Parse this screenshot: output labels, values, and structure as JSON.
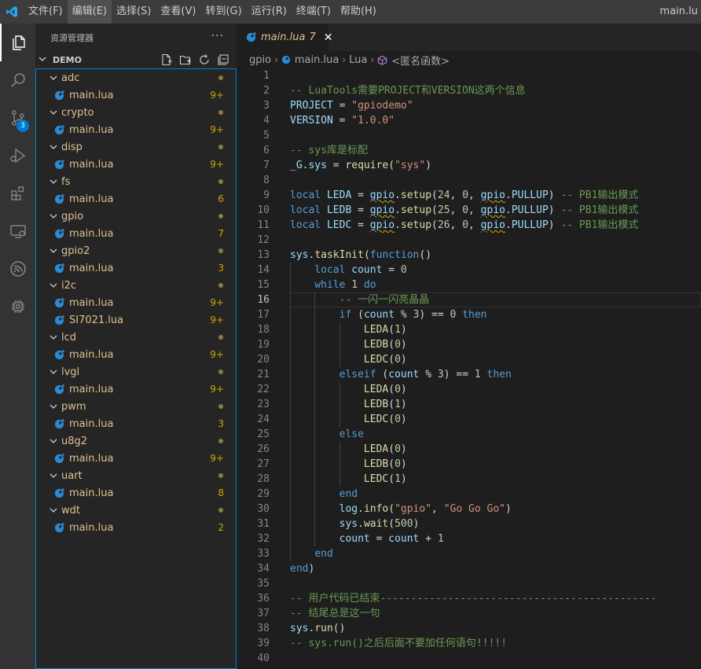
{
  "titlebar": {
    "menu": [
      "文件(F)",
      "编辑(E)",
      "选择(S)",
      "查看(V)",
      "转到(G)",
      "运行(R)",
      "终端(T)",
      "帮助(H)"
    ],
    "window_title": "main.lu"
  },
  "activity": {
    "icons": [
      "explorer-icon",
      "search-icon",
      "source-control-icon",
      "run-debug-icon",
      "extensions-icon",
      "remote-explorer-icon",
      "wifi-icon",
      "chip-icon"
    ],
    "scm_badge": "3"
  },
  "sidebar": {
    "title": "资源管理器",
    "workspace": "DEMO",
    "tree": [
      {
        "folder": "adc",
        "files": [
          {
            "name": "main.lua",
            "count": "9+"
          }
        ]
      },
      {
        "folder": "crypto",
        "files": [
          {
            "name": "main.lua",
            "count": "9+"
          }
        ]
      },
      {
        "folder": "disp",
        "files": [
          {
            "name": "main.lua",
            "count": "9+"
          }
        ]
      },
      {
        "folder": "fs",
        "files": [
          {
            "name": "main.lua",
            "count": "6"
          }
        ]
      },
      {
        "folder": "gpio",
        "files": [
          {
            "name": "main.lua",
            "count": "7"
          }
        ]
      },
      {
        "folder": "gpio2",
        "files": [
          {
            "name": "main.lua",
            "count": "3"
          }
        ]
      },
      {
        "folder": "i2c",
        "files": [
          {
            "name": "main.lua",
            "count": "9+"
          },
          {
            "name": "SI7021.lua",
            "count": "9+"
          }
        ]
      },
      {
        "folder": "lcd",
        "files": [
          {
            "name": "main.lua",
            "count": "9+"
          }
        ]
      },
      {
        "folder": "lvgl",
        "files": [
          {
            "name": "main.lua",
            "count": "9+"
          }
        ]
      },
      {
        "folder": "pwm",
        "files": [
          {
            "name": "main.lua",
            "count": "3"
          }
        ]
      },
      {
        "folder": "u8g2",
        "files": [
          {
            "name": "main.lua",
            "count": "9+"
          }
        ]
      },
      {
        "folder": "uart",
        "files": [
          {
            "name": "main.lua",
            "count": "8"
          }
        ]
      },
      {
        "folder": "wdt",
        "files": [
          {
            "name": "main.lua",
            "count": "2"
          }
        ]
      }
    ]
  },
  "editor": {
    "tab": {
      "label": "main.lua",
      "problems": "7",
      "close": "✕"
    },
    "breadcrumb": [
      "gpio",
      "main.lua",
      "Lua",
      "<匿名函数>"
    ],
    "current_line": 16,
    "lines": [
      "",
      "-- LuaTools需要PROJECT和VERSION这两个信息",
      "PROJECT = \"gpiodemo\"",
      "VERSION = \"1.0.0\"",
      "",
      "-- sys库是标配",
      "_G.sys = require(\"sys\")",
      "",
      "local LEDA = gpio.setup(24, 0, gpio.PULLUP) -- PB1输出模式",
      "local LEDB = gpio.setup(25, 0, gpio.PULLUP) -- PB1输出模式",
      "local LEDC = gpio.setup(26, 0, gpio.PULLUP) -- PB1输出模式",
      "",
      "sys.taskInit(function()",
      "    local count = 0",
      "    while 1 do",
      "        -- 一闪一闪亮晶晶",
      "        if (count % 3) == 0 then",
      "            LEDA(1)",
      "            LEDB(0)",
      "            LEDC(0)",
      "        elseif (count % 3) == 1 then",
      "            LEDA(0)",
      "            LEDB(1)",
      "            LEDC(0)",
      "        else",
      "            LEDA(0)",
      "            LEDB(0)",
      "            LEDC(1)",
      "        end",
      "        log.info(\"gpio\", \"Go Go Go\")",
      "        sys.wait(500)",
      "        count = count + 1",
      "    end",
      "end)",
      "",
      "-- 用户代码已结束---------------------------------------------",
      "-- 结尾总是这一句",
      "sys.run()",
      "-- sys.run()之后后面不要加任何语句!!!!!",
      ""
    ]
  },
  "colors": {
    "accent": "#007acc",
    "modified": "#e2c08d",
    "warning": "#cca700"
  }
}
